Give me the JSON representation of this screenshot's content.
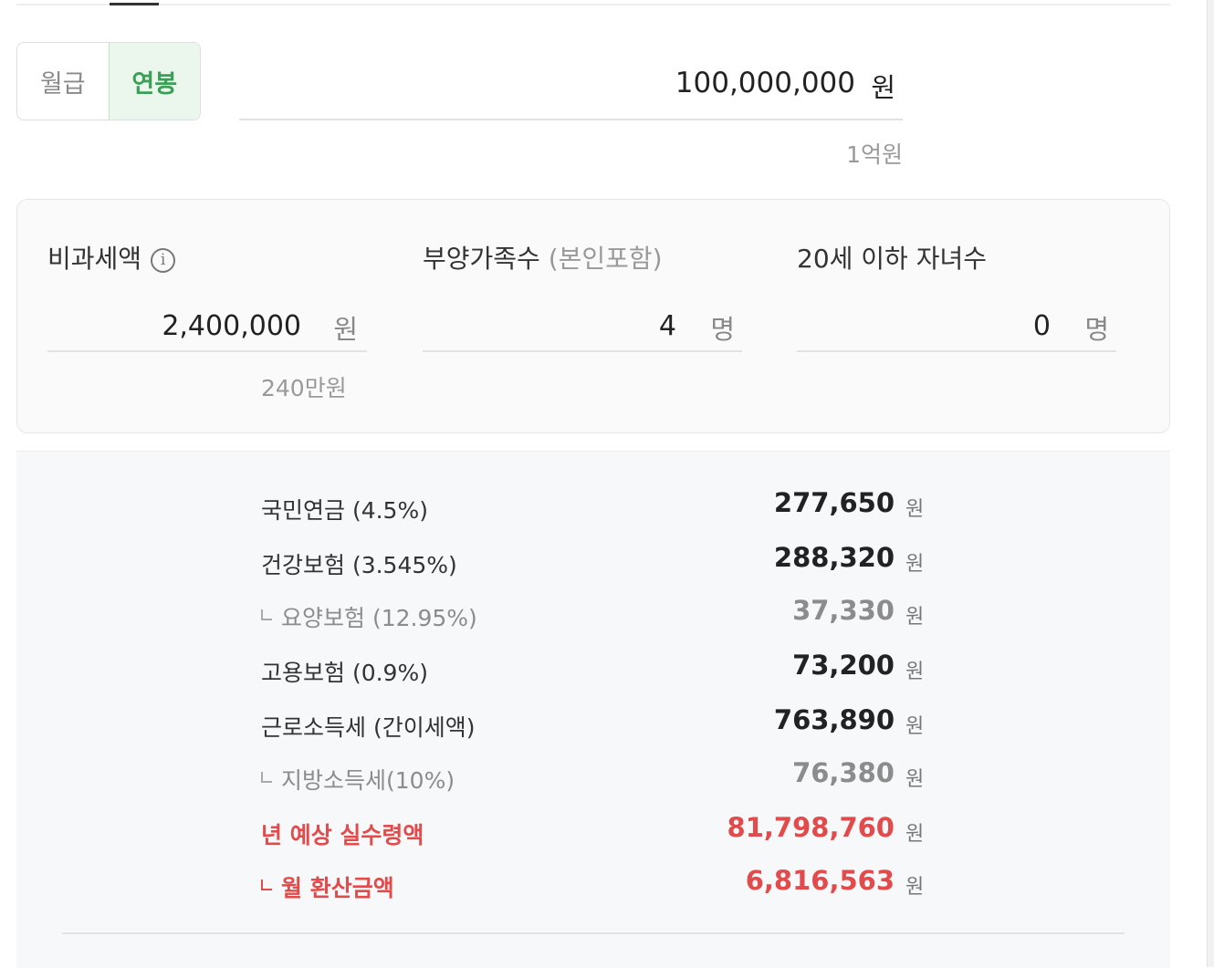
{
  "toggle": {
    "monthly": "월급",
    "annual": "연봉",
    "selected": "annual"
  },
  "salary": {
    "value": "100,000,000",
    "unit": "원",
    "hint": "1억원"
  },
  "inputs": {
    "nontax": {
      "label": "비과세액",
      "icon": "info-icon",
      "value": "2,400,000",
      "unit": "원",
      "hint": "240만원"
    },
    "dependents": {
      "label": "부양가족수",
      "sub": "(본인포함)",
      "value": "4",
      "unit": "명"
    },
    "children": {
      "label": "20세 이하 자녀수",
      "value": "0",
      "unit": "명"
    }
  },
  "results": [
    {
      "label": "국민연금 (4.5%)",
      "value": "277,650",
      "unit": "원",
      "style": "main"
    },
    {
      "label": "건강보험 (3.545%)",
      "value": "288,320",
      "unit": "원",
      "style": "main"
    },
    {
      "label": "요양보험 (12.95%)",
      "value": "37,330",
      "unit": "원",
      "style": "sub"
    },
    {
      "label": "고용보험 (0.9%)",
      "value": "73,200",
      "unit": "원",
      "style": "main"
    },
    {
      "label": "근로소득세 (간이세액)",
      "value": "763,890",
      "unit": "원",
      "style": "main"
    },
    {
      "label": "지방소득세(10%)",
      "value": "76,380",
      "unit": "원",
      "style": "sub"
    },
    {
      "label": "년 예상 실수령액",
      "value": "81,798,760",
      "unit": "원",
      "style": "red"
    },
    {
      "label": "월 환산금액",
      "value": "6,816,563",
      "unit": "원",
      "style": "red-sub"
    }
  ],
  "colors": {
    "accent_green": "#3c9f58",
    "highlight_red": "#e24b4b"
  }
}
